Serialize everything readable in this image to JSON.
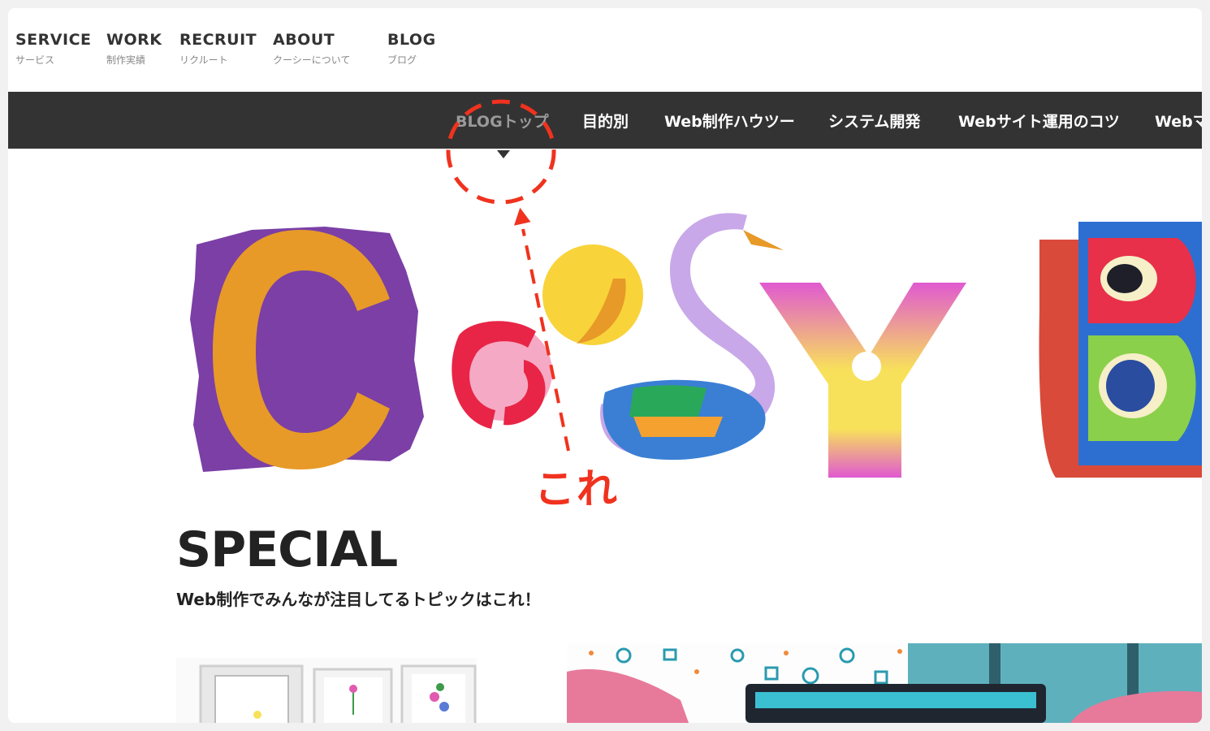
{
  "topnav": {
    "items": [
      {
        "en": "SERVICE",
        "ja": "サービス"
      },
      {
        "en": "WORK",
        "ja": "制作実績"
      },
      {
        "en": "RECRUIT",
        "ja": "リクルート"
      },
      {
        "en": "ABOUT",
        "ja": "クーシーについて"
      },
      {
        "en": "BLOG",
        "ja": "ブログ"
      }
    ]
  },
  "subnav": {
    "items": [
      {
        "label": "BLOGトップ",
        "active": true
      },
      {
        "label": "目的別"
      },
      {
        "label": "Web制作ハウツー"
      },
      {
        "label": "システム開発"
      },
      {
        "label": "Webサイト運用のコツ"
      },
      {
        "label": "Webマ"
      }
    ]
  },
  "annotation": {
    "text": "これ",
    "color": "#f0321e"
  },
  "hero": {
    "logo_letters": "COOSY B"
  },
  "special": {
    "title": "SPECIAL",
    "subtitle": "Web制作でみんなが注目してるトピックはこれ！"
  },
  "colors": {
    "subnav_bg": "#333333",
    "annotation": "#f0321e"
  }
}
